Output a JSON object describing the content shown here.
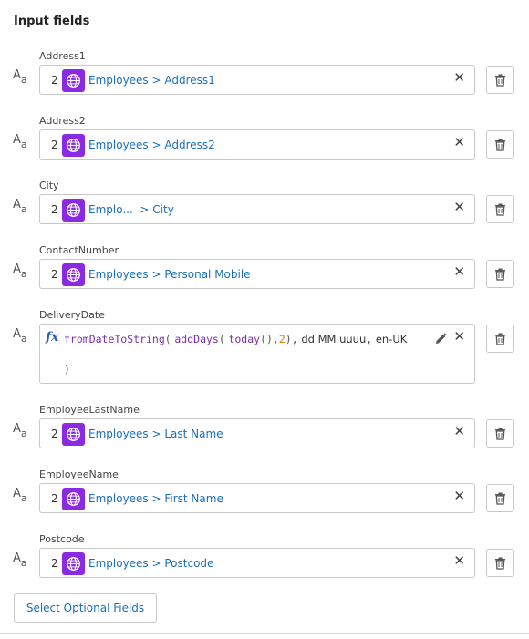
{
  "panel": {
    "title": "Input fields"
  },
  "fields": [
    {
      "label": "Address1",
      "ref_index": "2",
      "ref_text": "Employees > Address1"
    },
    {
      "label": "Address2",
      "ref_index": "2",
      "ref_text": "Employees > Address2"
    },
    {
      "label": "City",
      "ref_index": "2",
      "ref_text": "Emplo...  > City"
    },
    {
      "label": "ContactNumber",
      "ref_index": "2",
      "ref_text": "Employees > Personal Mobile"
    },
    {
      "label": "EmployeeLastName",
      "ref_index": "2",
      "ref_text": "Employees > Last Name"
    },
    {
      "label": "EmployeeName",
      "ref_index": "2",
      "ref_text": "Employees > First Name"
    },
    {
      "label": "Postcode",
      "ref_index": "2",
      "ref_text": "Employees > Postcode"
    }
  ],
  "formula_field": {
    "label": "DeliveryDate",
    "fx_symbol": "fx",
    "fn1": "fromDateToString",
    "open1": "(",
    "fn2": "addDays",
    "open2": "(",
    "fn3": "today",
    "call3": "()",
    "comma1": ",",
    "number": "2",
    "close2": ")",
    "comma2": ",",
    "format_literal": "dd MM uuuu",
    "comma3": ",",
    "locale_literal": "en-UK",
    "close1": ")"
  },
  "actions": {
    "select_optional": "Select Optional Fields"
  },
  "icons": {
    "type": "text-type-icon",
    "globe": "globe-icon",
    "clear": "close-icon",
    "delete": "trash-icon",
    "edit": "pencil-icon"
  },
  "colors": {
    "accent": "#1a6fb8",
    "globe_bg": "#8a2be2",
    "function": "#7b2fa6",
    "number": "#d08700"
  }
}
